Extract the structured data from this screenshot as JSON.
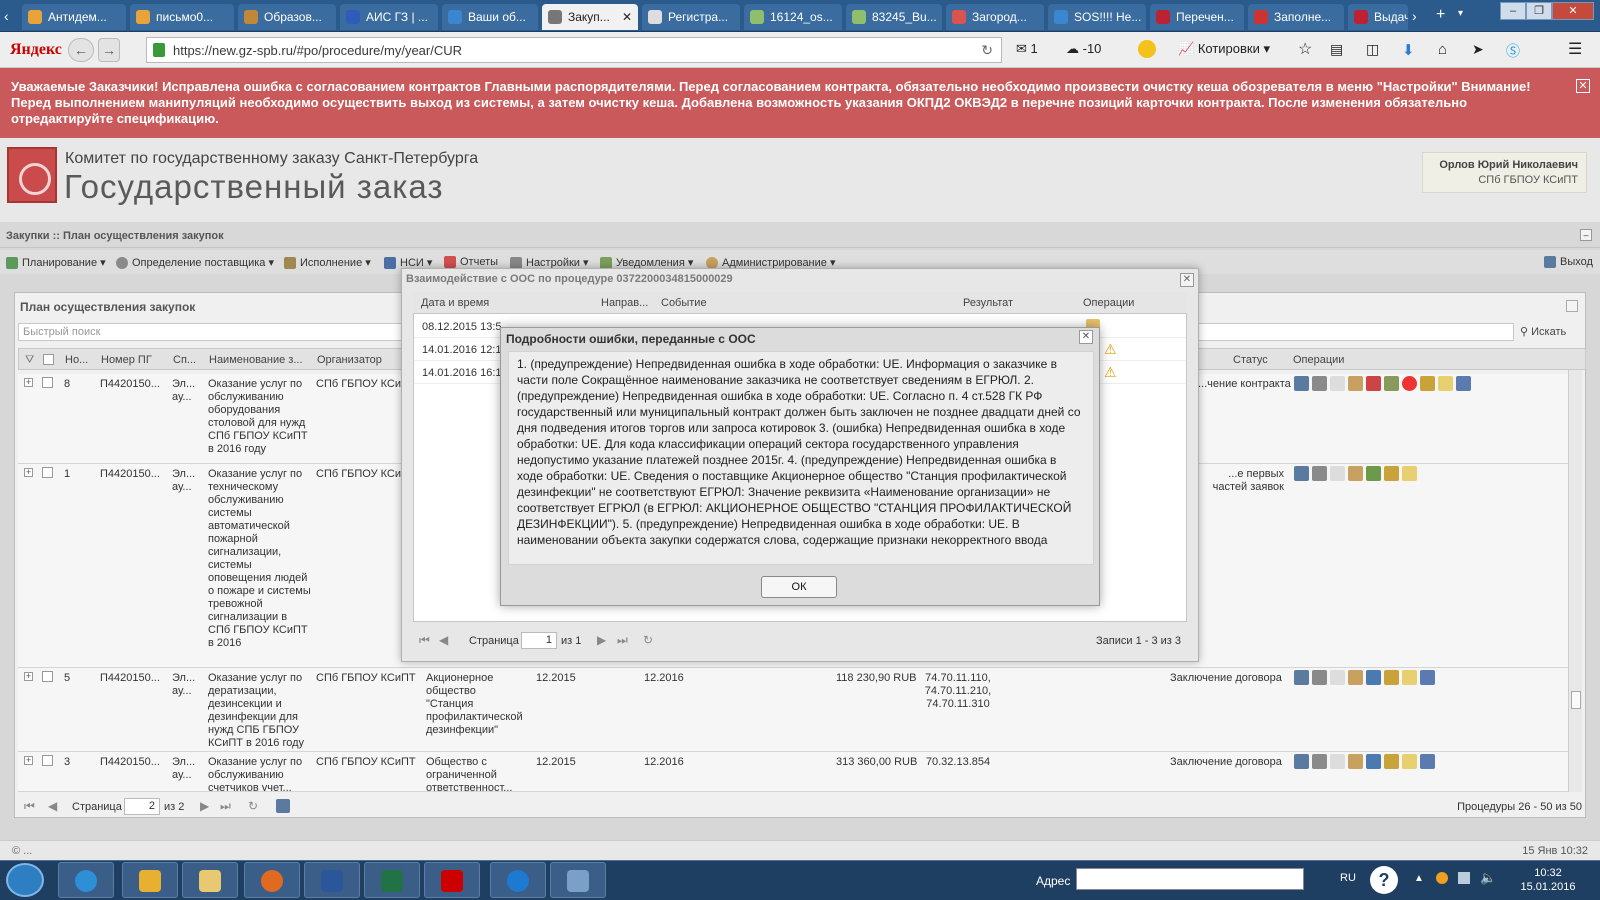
{
  "browser": {
    "tabs": [
      {
        "label": "Антидем..."
      },
      {
        "label": "письмо0..."
      },
      {
        "label": "Образов..."
      },
      {
        "label": "АИС ГЗ | ..."
      },
      {
        "label": "Ваши об..."
      },
      {
        "label": "Закуп...",
        "active": true
      },
      {
        "label": "Регистра..."
      },
      {
        "label": "16124_os..."
      },
      {
        "label": "83245_Bu..."
      },
      {
        "label": "Загород..."
      },
      {
        "label": "SOS!!!! Не..."
      },
      {
        "label": "Перечен..."
      },
      {
        "label": "Заполне..."
      },
      {
        "label": "Выдача..."
      }
    ],
    "logo": "Яндекс",
    "url": "https://new.gz-spb.ru/#po/procedure/my/year/CUR",
    "mail_count": "1",
    "weather": "-10",
    "quotes_label": "Котировки",
    "tab_close": "✕",
    "new_tab": "+"
  },
  "banner": {
    "text": "Уважаемые Заказчики! Исправлена ошибка с согласованием контрактов Главными распорядителями. Перед согласованием контракта, обязательно необходимо произвести очистку кеша обозревателя в меню \"Настройки\" Внимание! Перед выполнением манипуляций необходимо осуществить выход из системы, а затем очистку кеша. Добавлена возможность указания ОКПД2 ОКВЭД2 в перечне позиций карточки контракта. После изменения обязательно отредактируйте спецификацию.",
    "close": "✕"
  },
  "header": {
    "org_sub": "Комитет по государственному заказу Санкт-Петербурга",
    "org_title": "Государственный заказ",
    "user_name": "Орлов Юрий Николаевич",
    "user_org": "СПб ГБПОУ КСиПТ"
  },
  "breadcrumb": "Закупки :: План осуществления закупок",
  "menu": [
    {
      "label": "Планирование ▾"
    },
    {
      "label": "Определение поставщика ▾"
    },
    {
      "label": "Исполнение ▾"
    },
    {
      "label": "НСИ ▾"
    },
    {
      "label": "Отчеты"
    },
    {
      "label": "Настройки ▾"
    },
    {
      "label": "Уведомления ▾"
    },
    {
      "label": "Администрирование ▾"
    }
  ],
  "exit_label": "Выход",
  "panel": {
    "title": "План осуществления закупок",
    "search_placeholder": "Быстрый поиск",
    "search_button": "Искать",
    "columns": [
      "Но...",
      "Номер ПГ",
      "Сп...",
      "Наименование з...",
      "Организатор",
      "Статус",
      "Операции"
    ],
    "rows": [
      {
        "num": "8",
        "pg": "П4420150...",
        "sp": "Эл... ау...",
        "name": "Оказание услуг по обслуживанию оборудования столовой для нужд СПб ГБПОУ КСиПТ в 2016 году",
        "org": "СПб ГБПОУ КСиГ",
        "supplier": "",
        "d1": "",
        "d2": "",
        "amount": "",
        "okpd": "",
        "status": "...чение контракта"
      },
      {
        "num": "1",
        "pg": "П4420150...",
        "sp": "Эл... ау...",
        "name": "Оказание услуг по техническому обслуживанию системы автоматической пожарной сигнализации, системы оповещения людей о пожаре и системы тревожной сигнализации в СПб ГБПОУ КСиПТ в 2016",
        "org": "СПб ГБПОУ КСиГ",
        "supplier": "",
        "d1": "",
        "d2": "",
        "amount": "",
        "okpd": "",
        "status": "...е первых частей заявок"
      },
      {
        "num": "5",
        "pg": "П4420150...",
        "sp": "Эл... ау...",
        "name": "Оказание услуг по дератизации, дезинсекции и дезинфекции для нужд СПБ ГБПОУ КСиПТ в 2016 году",
        "org": "СПб ГБПОУ КСиПТ",
        "supplier": "Акционерное общество \"Станция профилактической дезинфекции\"",
        "d1": "12.2015",
        "d2": "12.2016",
        "amount": "118 230,90 RUB",
        "okpd": "74.70.11.110, 74.70.11.210, 74.70.11.310",
        "status": "Заключение договора"
      },
      {
        "num": "3",
        "pg": "П4420150...",
        "sp": "Эл... ау...",
        "name": "Оказание услуг по обслуживанию счетчиков учет...",
        "org": "СПб ГБПОУ КСиПТ",
        "supplier": "Общество с ограниченной ответственност...",
        "d1": "12.2015",
        "d2": "12.2016",
        "amount": "313 360,00 RUB",
        "okpd": "70.32.13.854",
        "status": "Заключение договора"
      }
    ],
    "page_label": "Страница",
    "page_value": "2",
    "page_of": "из 2",
    "records": "Процедуры 26 - 50 из 50"
  },
  "dialog_ooc": {
    "title": "Взаимодействие с ООС по процедуре 0372200034815000029",
    "columns": [
      "Дата и время",
      "Направ...",
      "Событие",
      "Результат",
      "Операции"
    ],
    "rows": [
      {
        "date": "08.12.2015 13:5..."
      },
      {
        "date": "14.01.2016 12:1..."
      },
      {
        "date": "14.01.2016 16:1..."
      }
    ],
    "page_label": "Страница",
    "page_value": "1",
    "page_of": "из 1",
    "records": "Записи 1 - 3 из 3",
    "close": "✕"
  },
  "error_dialog": {
    "title": "Подробности ошибки, переданные с ООС",
    "body": "1. (предупреждение) Непредвиденная ошибка в ходе обработки: UE. Информация о заказчике в части поле Сокращённое наименование заказчика не соответствует сведениям в ЕГРЮЛ. 2. (предупреждение) Непредвиденная ошибка в ходе обработки: UE. Согласно п. 4 ст.528 ГК РФ государственный или муниципальный контракт должен быть заключен не позднее двадцати дней со дня подведения итогов торгов или запроса котировок 3. (ошибка) Непредвиденная ошибка в ходе обработки: UE. Для кода классификации операций сектора государственного управления недопустимо указание платежей позднее 2015г. 4. (предупреждение) Непредвиденная ошибка в ходе обработки: UE. Сведения о поставщике Акционерное общество \"Станция профилактической дезинфекции\" не соответствуют ЕГРЮЛ: Значение реквизита «Наименование организации» не соответствует ЕГРЮЛ (в ЕГРЮЛ: АКЦИОНЕРНОЕ ОБЩЕСТВО \"СТАНЦИЯ ПРОФИЛАКТИЧЕСКОЙ ДЕЗИНФЕКЦИИ\"). 5. (предупреждение) Непредвиденная ошибка в ходе обработки: UE. В наименовании объекта закупки содержатся слова, содержащие признаки некорректного ввода",
    "ok_label": "ОК",
    "close": "✕"
  },
  "statusbar": {
    "left": "© ...",
    "right": "15 Янв 10:32"
  },
  "taskbar": {
    "address_label": "Адрес",
    "lang": "RU",
    "time": "10:32",
    "date": "15.01.2016"
  },
  "colors": {
    "banner": "#c9595a",
    "tabbar": "#2b5b8c",
    "taskbar": "#1f3f62"
  }
}
